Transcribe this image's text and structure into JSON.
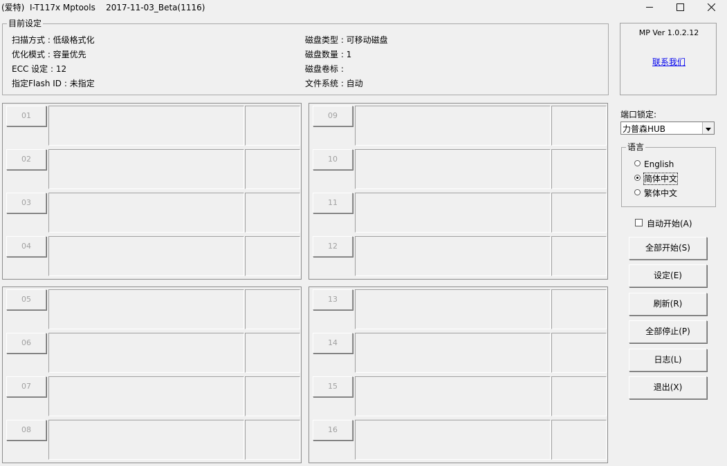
{
  "window": {
    "title": "(爱特)  I-T117x Mptools    2017-11-03_Beta(1116)",
    "minimize_icon": "minimize-icon",
    "maximize_icon": "maximize-icon",
    "close_icon": "close-icon"
  },
  "current_settings": {
    "legend": "目前设定",
    "left": [
      "扫描方式 : 低级格式化",
      "优化模式 : 容量优先",
      "ECC 设定 : 12",
      "指定Flash ID : 未指定"
    ],
    "right": [
      "磁盘类型 : 可移动磁盘",
      "磁盘数量 : 1",
      "磁盘卷标 :",
      "文件系统 : 自动"
    ]
  },
  "ports": [
    "01",
    "02",
    "03",
    "04",
    "05",
    "06",
    "07",
    "08",
    "09",
    "10",
    "11",
    "12",
    "13",
    "14",
    "15",
    "16"
  ],
  "info": {
    "version": "MP Ver 1.0.2.12",
    "contact": "联系我们"
  },
  "port_lock": {
    "label": "端口锁定:",
    "value": "力普森HUB",
    "arrow_icon": "chevron-down-icon"
  },
  "language": {
    "legend": "语言",
    "options": [
      "English",
      "简体中文",
      "繁体中文"
    ],
    "selected": "简体中文"
  },
  "autostart": {
    "label": "自动开始(A)",
    "checked": false
  },
  "actions": {
    "start_all": "全部开始(S)",
    "settings": "设定(E)",
    "refresh": "刷新(R)",
    "stop_all": "全部停止(P)",
    "log": "日志(L)",
    "exit": "退出(X)"
  }
}
